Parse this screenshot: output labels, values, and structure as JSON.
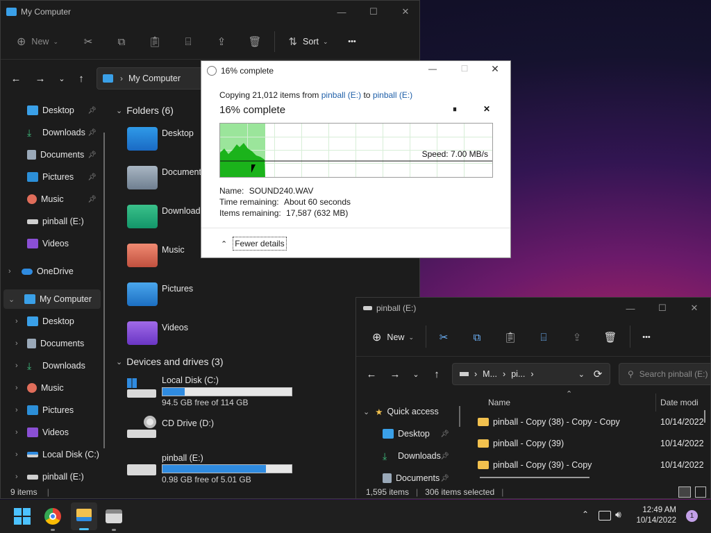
{
  "main_window": {
    "title": "My Computer",
    "toolbar": {
      "new_label": "New",
      "sort_label": "Sort",
      "more": "•••"
    },
    "address": "My Computer",
    "nav_items": [
      {
        "label": "Desktop",
        "pinned": true
      },
      {
        "label": "Downloads",
        "pinned": true
      },
      {
        "label": "Documents",
        "pinned": true
      },
      {
        "label": "Pictures",
        "pinned": true
      },
      {
        "label": "Music",
        "pinned": true
      },
      {
        "label": "pinball (E:)",
        "pinned": false
      },
      {
        "label": "Videos",
        "pinned": false
      }
    ],
    "onedrive": "OneDrive",
    "my_computer": "My Computer",
    "tree_items": [
      "Desktop",
      "Documents",
      "Downloads",
      "Music",
      "Pictures",
      "Videos",
      "Local Disk (C:)",
      "pinball (E:)"
    ],
    "folders_header": "Folders (6)",
    "folders": [
      "Desktop",
      "Documents",
      "Downloads",
      "Music",
      "Pictures",
      "Videos"
    ],
    "drives_header": "Devices and drives (3)",
    "drives": [
      {
        "name": "Local Disk (C:)",
        "free": "94.5 GB free of 114 GB",
        "used_fraction": 0.17
      },
      {
        "name": "CD Drive (D:)",
        "free": "",
        "used_fraction": null
      },
      {
        "name": "pinball (E:)",
        "free": "0.98 GB free of 5.01 GB",
        "used_fraction": 0.8
      }
    ],
    "status": "9 items"
  },
  "progress_dialog": {
    "title": "16% complete",
    "copy_prefix": "Copying 21,012 items from",
    "from": "pinball (E:)",
    "to_word": "to",
    "to": "pinball (E:)",
    "heading": "16% complete",
    "speed": "Speed: 7.00 MB/s",
    "name_label": "Name:",
    "name_value": "SOUND240.WAV",
    "time_label": "Time remaining:",
    "time_value": "About 60 seconds",
    "items_label": "Items remaining:",
    "items_value": "17,587 (632 MB)",
    "fewer_details": "Fewer details",
    "progress_fraction": 0.16
  },
  "second_window": {
    "title": "pinball (E:)",
    "new_label": "New",
    "more": "•••",
    "breadcrumb": [
      "M...",
      "pi..."
    ],
    "search_placeholder": "Search pinball (E:)",
    "quick_access": "Quick access",
    "nav_items": [
      "Desktop",
      "Downloads",
      "Documents"
    ],
    "col_name": "Name",
    "col_date": "Date modi",
    "rows": [
      {
        "name": "pinball - Copy (38) - Copy - Copy",
        "date": "10/14/2022"
      },
      {
        "name": "pinball - Copy (39)",
        "date": "10/14/2022"
      },
      {
        "name": "pinball - Copy (39) - Copy",
        "date": "10/14/2022"
      }
    ],
    "status_items": "1,595 items",
    "status_selected": "306 items selected"
  },
  "taskbar": {
    "time": "12:49 AM",
    "date": "10/14/2022",
    "notification_count": "1"
  }
}
